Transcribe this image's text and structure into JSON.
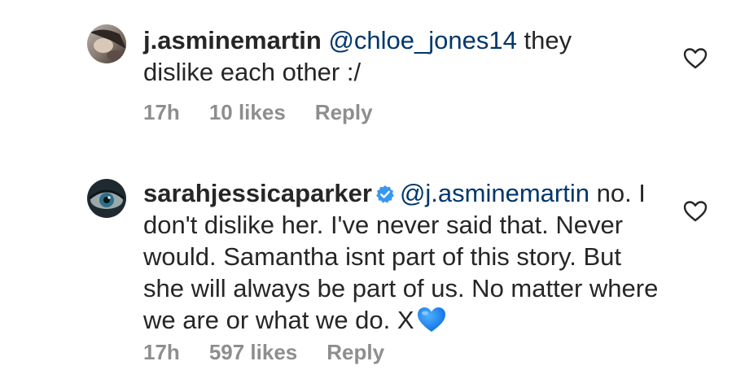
{
  "comments": [
    {
      "username": "j.asminemartin",
      "mention": "@chloe_jones14",
      "text_line1": " they",
      "text_rest": "dislike each other :/",
      "time": "17h",
      "likes": "10 likes",
      "reply": "Reply",
      "verified": false,
      "avatar_icon": "user-avatar-photo"
    },
    {
      "username": "sarahjessicaparker",
      "mention": "@j.asminemartin",
      "text": "no. I don't dislike her.  I've never said that. Never would. Samantha isnt part of this story. But she will always be part of us. No matter where we are or what we do. X",
      "trailing_emoji": "blue-heart-emoji",
      "time": "17h",
      "likes": "597 likes",
      "reply": "Reply",
      "verified": true,
      "avatar_icon": "eye-avatar-photo"
    }
  ],
  "colors": {
    "text": "#262626",
    "mention": "#00376b",
    "meta": "#8e8e8e",
    "verified_badge": "#3897f0",
    "blue_heart": "#0a84ff"
  }
}
